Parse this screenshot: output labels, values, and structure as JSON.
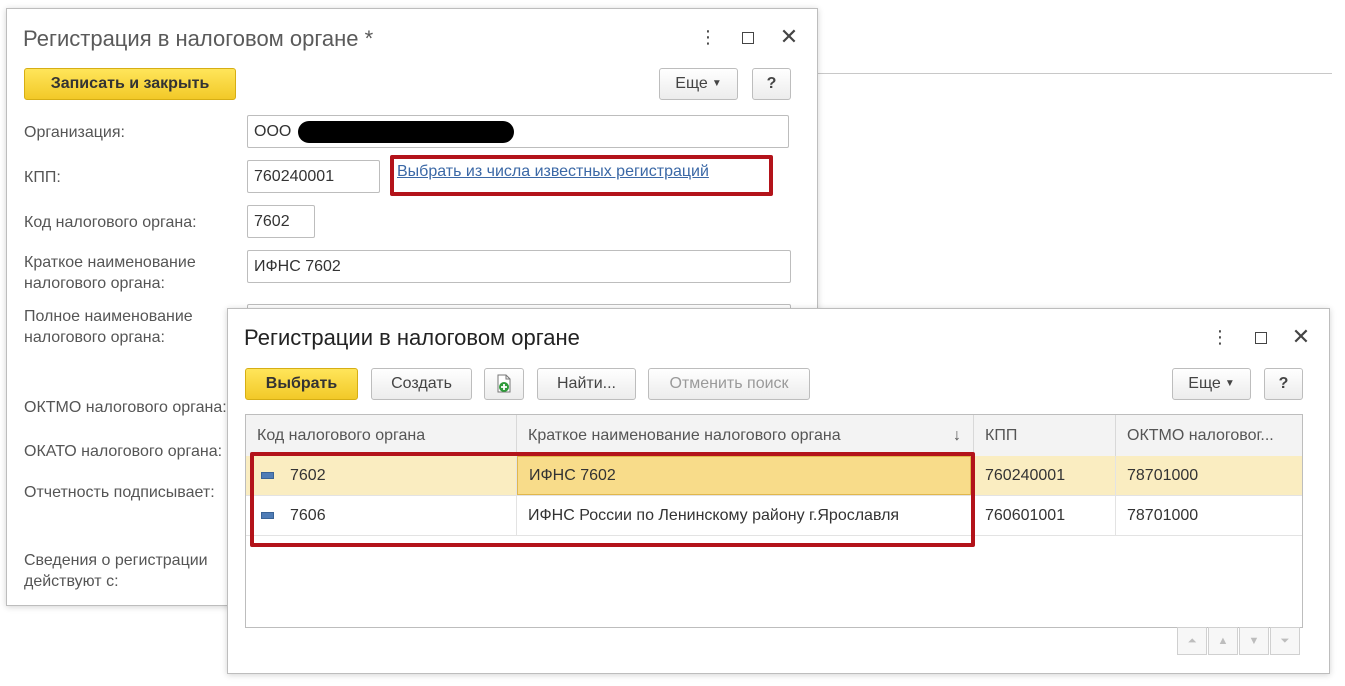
{
  "form": {
    "title": "Регистрация в налоговом органе *",
    "more_icon": "⋮",
    "save_close": "Записать и закрыть",
    "more_label": "Еще",
    "help_label": "?",
    "labels": {
      "org": "Организация:",
      "kpp": "КПП:",
      "code": "Код налогового органа:",
      "short_name": "Краткое наименование налогового органа:",
      "full_name": "Полное наименование налогового органа:",
      "oktmo": "ОКТМО налогового органа:",
      "okato": "ОКАТО налогового органа:",
      "signer": "Отчетность подписывает:",
      "valid_from": "Сведения о регистрации действуют с:"
    },
    "values": {
      "org": "ООО",
      "kpp": "760240001",
      "code": "7602",
      "short_name": "ИФНС 7602"
    },
    "select_link": "Выбрать из числа известных регистраций"
  },
  "list": {
    "title": "Регистрации в налоговом органе",
    "more_icon": "⋮",
    "select": "Выбрать",
    "create": "Создать",
    "find": "Найти...",
    "cancel_search": "Отменить поиск",
    "more_label": "Еще",
    "help_label": "?",
    "columns": [
      "Код налогового органа",
      "Краткое наименование налогового органа",
      "КПП",
      "ОКТМО налоговог..."
    ],
    "sort_arrow": "↓",
    "rows": [
      {
        "code": "7602",
        "name": "ИФНС 7602",
        "kpp": "760240001",
        "oktmo": "78701000"
      },
      {
        "code": "7606",
        "name": "ИФНС России по Ленинскому району г.Ярославля",
        "kpp": "760601001",
        "oktmo": "78701000"
      }
    ]
  },
  "colors": {
    "accent_button": "#f2c928",
    "highlight_frame": "#b3131a",
    "selected_row": "#faedc1",
    "link": "#3b68a6"
  },
  "icons": [
    "more-vertical-icon",
    "maximize-icon",
    "close-icon",
    "add-copy-icon",
    "row-item-icon",
    "first-page-icon",
    "prev-page-icon",
    "next-page-icon",
    "last-page-icon"
  ]
}
